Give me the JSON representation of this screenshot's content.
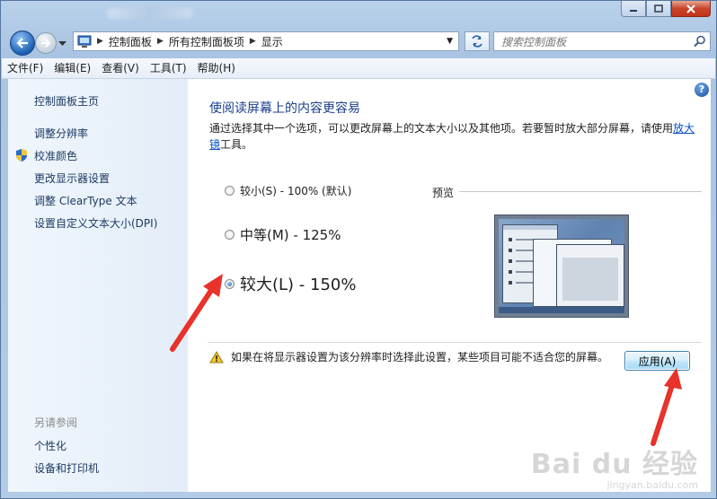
{
  "titlebar": {
    "title": "",
    "min_icon": "minimize-icon",
    "max_icon": "maximize-icon",
    "close_icon": "close-icon"
  },
  "address": {
    "crumbs": [
      "控制面板",
      "所有控制面板项",
      "显示"
    ],
    "search_placeholder": "搜索控制面板"
  },
  "menu": [
    "文件(F)",
    "编辑(E)",
    "查看(V)",
    "工具(T)",
    "帮助(H)"
  ],
  "sidebar": {
    "home": "控制面板主页",
    "links": [
      "调整分辨率",
      "校准颜色",
      "更改显示器设置",
      "调整 ClearType 文本",
      "设置自定义文本大小(DPI)"
    ],
    "see_also_heading": "另请参阅",
    "see_also": [
      "个性化",
      "设备和打印机"
    ]
  },
  "main": {
    "heading": "使阅读屏幕上的内容更容易",
    "desc_prefix": "通过选择其中一个选项，可以更改屏幕上的文本大小以及其他项。若要暂时放大部分屏幕，请使用",
    "desc_link": "放大镜",
    "desc_suffix": "工具。",
    "options": [
      {
        "label": "较小(S) - 100% (默认)",
        "checked": false
      },
      {
        "label": "中等(M) - 125%",
        "checked": false
      },
      {
        "label": "较大(L) - 150%",
        "checked": true
      }
    ],
    "preview_label": "预览",
    "warning": "如果在将显示器设置为该分辨率时选择此设置，某些项目可能不适合您的屏幕。",
    "apply_label": "应用(A)",
    "help_symbol": "?"
  },
  "watermark": {
    "line1": "Bai du 经验",
    "line2": "jingyan.baidu.com"
  },
  "colors": {
    "heading": "#1b3e8b",
    "link": "#0a50c8",
    "annotation_arrow": "#e8322a"
  }
}
